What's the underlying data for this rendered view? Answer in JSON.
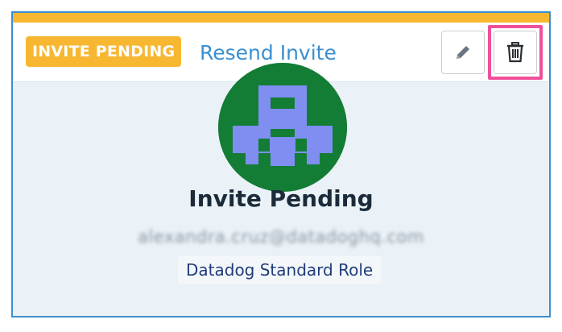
{
  "header": {
    "badge_label": "INVITE PENDING",
    "resend_label": "Resend Invite",
    "edit_icon": "pencil-icon",
    "delete_icon": "trash-icon"
  },
  "profile": {
    "display_name": "Invite Pending",
    "email": "alexandra.cruz@datadoghq.com",
    "role": "Datadog Standard Role"
  },
  "colors": {
    "badge_bg": "#f7b731",
    "link": "#3b8fd0",
    "card_border": "#3b8fd0",
    "highlight": "#f0509a",
    "avatar_bg": "#137d36",
    "avatar_fg": "#7f8ef0"
  }
}
